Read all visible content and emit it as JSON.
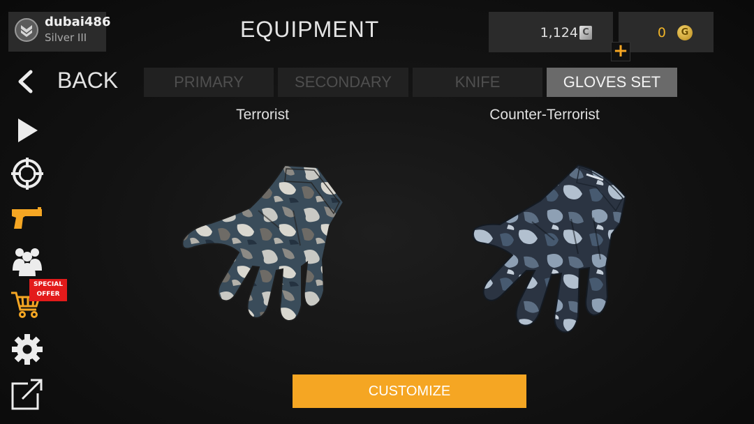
{
  "profile": {
    "username": "dubai486",
    "rank": "Silver III"
  },
  "header": {
    "title": "EQUIPMENT"
  },
  "currency": {
    "credits": "1,124",
    "gold": "0",
    "credits_icon": "C",
    "gold_icon": "G",
    "add_icon": "+"
  },
  "nav": {
    "back_label": "BACK",
    "items": [
      "play-icon",
      "crosshair-icon",
      "pistol-icon",
      "team-icon",
      "cart-icon",
      "gear-icon",
      "external-link-icon"
    ],
    "special_offer": "SPECIAL OFFER"
  },
  "tabs": [
    {
      "label": "PRIMARY",
      "active": false
    },
    {
      "label": "SECONDARY",
      "active": false
    },
    {
      "label": "KNIFE",
      "active": false
    },
    {
      "label": "GLOVES SET",
      "active": true
    }
  ],
  "teams": {
    "t_label": "Terrorist",
    "ct_label": "Counter-Terrorist"
  },
  "actions": {
    "customize_label": "CUSTOMIZE"
  },
  "colors": {
    "accent": "#f5a623",
    "gold_text": "#f0b428",
    "offer_red": "#e31b1b"
  }
}
